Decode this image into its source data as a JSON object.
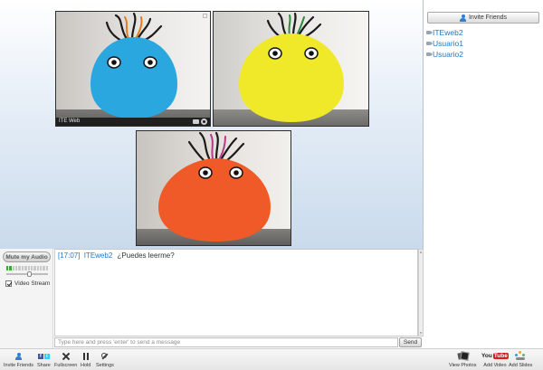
{
  "video_tiles": [
    {
      "caption": "ITE Web",
      "ball_color": "#2aa7de"
    },
    {
      "ball_color": "#f0e92a"
    },
    {
      "ball_color": "#ef5a28"
    }
  ],
  "user_panel": {
    "invite_label": "Invite Friends",
    "users": [
      "ITEweb2",
      "Usuario1",
      "Usuario2"
    ]
  },
  "audio": {
    "mute_label": "Mute my Audio",
    "meter_segments": 14,
    "meter_active": 2,
    "volume_level": 0.55,
    "video_stream_label": "Video Stream",
    "video_stream_checked": true
  },
  "chat": {
    "messages": [
      {
        "time": "[17:07]",
        "user": "ITEweb2",
        "text": "¿Puedes   leerme?"
      }
    ],
    "input_placeholder": "Type here and press 'enter' to send a message",
    "send_label": "Send"
  },
  "toolbar": {
    "invite_friends": "Invite Friends",
    "share": "Share",
    "fullscreen": "Fullscreen",
    "hold": "Hold",
    "settings": "Settings",
    "view_photos": "View Photos",
    "add_video": "Add Video",
    "add_slides": "Add Slides",
    "youtube_you": "You",
    "youtube_tube": "Tube"
  },
  "colors": {
    "accent_link": "#2277bb",
    "meter_active": "#3aa63a",
    "youtube_red": "#d21d1d"
  }
}
